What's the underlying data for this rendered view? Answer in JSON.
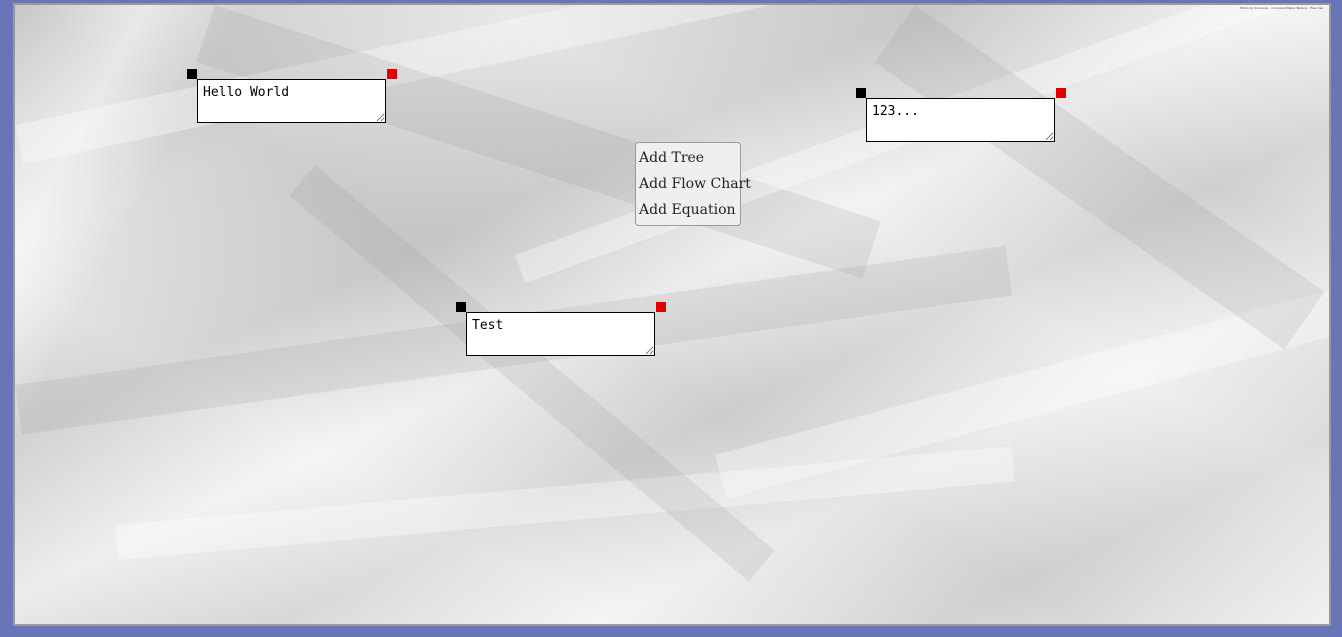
{
  "credit": "Photo by Someone · Crumpled Paper Texture · Free Use",
  "notes": [
    {
      "id": "note-1",
      "text": "Hello World"
    },
    {
      "id": "note-2",
      "text": "123..."
    },
    {
      "id": "note-3",
      "text": "Test"
    }
  ],
  "context_menu": {
    "items": [
      {
        "label": "Add Tree"
      },
      {
        "label": "Add Flow Chart"
      },
      {
        "label": "Add Equation"
      }
    ]
  },
  "colors": {
    "frame": "#6a74b8",
    "drag_handle": "#000000",
    "close_handle": "#e00000",
    "menu_background": "#efefef"
  },
  "icons": {
    "drag_handle": "move-handle-icon",
    "close_handle": "close-icon"
  }
}
